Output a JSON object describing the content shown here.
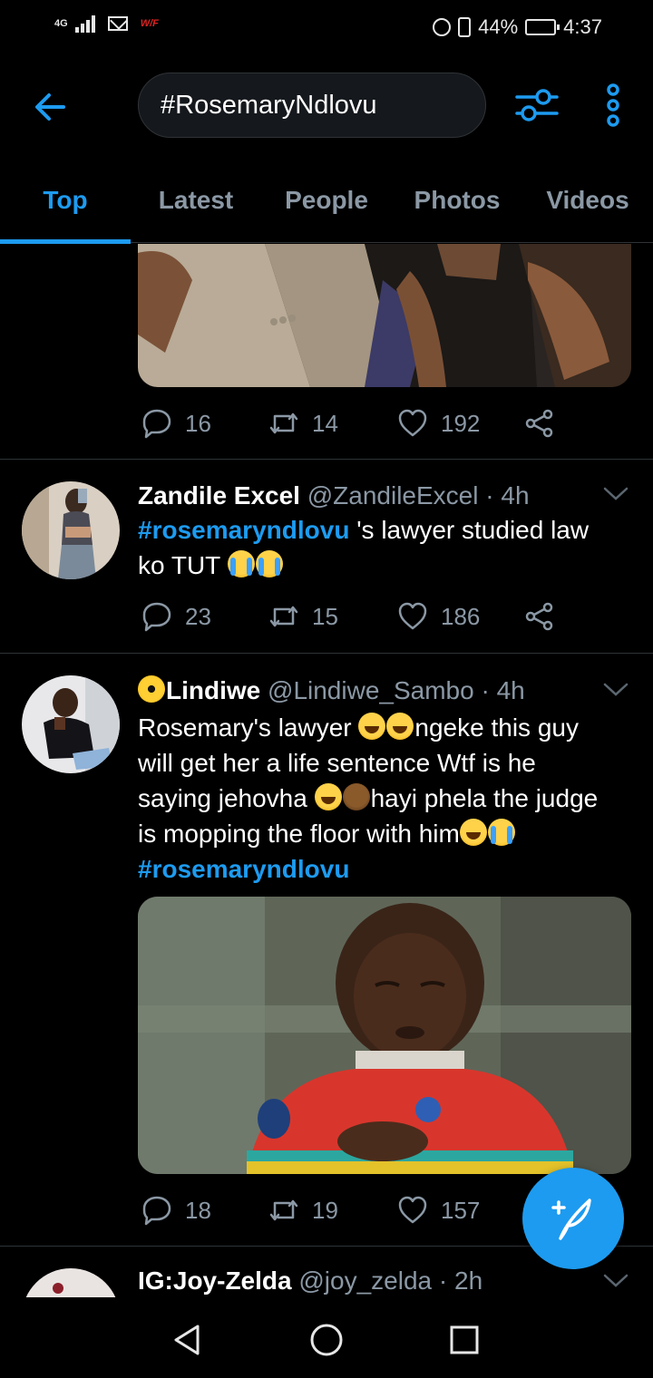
{
  "status_bar": {
    "network": "4G",
    "carrier_badge": "W/F",
    "battery": "44%",
    "time": "4:37"
  },
  "search": {
    "query": "#RosemaryNdlovu"
  },
  "tabs": [
    {
      "label": "Top",
      "active": true
    },
    {
      "label": "Latest",
      "active": false
    },
    {
      "label": "People",
      "active": false
    },
    {
      "label": "Photos",
      "active": false
    },
    {
      "label": "Videos",
      "active": false
    }
  ],
  "tweets": [
    {
      "partial": true,
      "media": "photo-man-in-suit-praying",
      "replies": "16",
      "retweets": "14",
      "likes": "192"
    },
    {
      "name": "Zandile Excel",
      "handle": "@ZandileExcel",
      "time": "· 4h",
      "text_hashtag": "#rosemaryndlovu",
      "text_line1": " 's lawyer studied law",
      "text_line2": "ko TUT ",
      "emojis": [
        "loudly-crying-face",
        "loudly-crying-face"
      ],
      "replies": "23",
      "retweets": "15",
      "likes": "186"
    },
    {
      "name": "Lindiwe",
      "handle": "@Lindiwe_Sambo",
      "time": "· 4h",
      "text_line1a": "Rosemary's lawyer ",
      "text_line1b": "ngeke this guy",
      "text_line2": "will get her a life sentence Wtf is he",
      "text_line3a": "saying jehovha ",
      "text_line3b": "hayi phela the judge",
      "text_line4": "is mopping the floor with him",
      "text_hashtag": "#rosemaryndlovu",
      "media": "photo-child-sleeping-red-shirt",
      "replies": "18",
      "retweets": "19",
      "likes": "157"
    },
    {
      "name": "IG:Joy-Zelda",
      "handle": "@joy_zelda",
      "time": "· 2h"
    }
  ],
  "colors": {
    "accent": "#1d9bf0",
    "background": "#000000",
    "muted_text": "#8b98a5",
    "divider": "#2f3336"
  },
  "icons": [
    "back-arrow-icon",
    "filter-sliders-icon",
    "more-vertical-icon",
    "reply-icon",
    "retweet-icon",
    "like-icon",
    "share-icon",
    "chevron-down-icon",
    "compose-icon",
    "back-triangle-icon",
    "home-circle-icon",
    "recents-square-icon"
  ]
}
